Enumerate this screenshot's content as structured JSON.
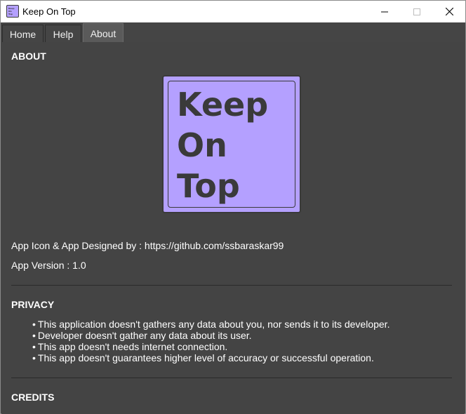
{
  "window": {
    "title": "Keep On Top",
    "icon_text": [
      "Keep",
      "On",
      "Top"
    ]
  },
  "tabs": [
    {
      "label": "Home",
      "selected": false
    },
    {
      "label": "Help",
      "selected": false
    },
    {
      "label": "About",
      "selected": true
    }
  ],
  "about": {
    "heading": "ABOUT",
    "logo_lines": [
      "Keep",
      "On",
      "Top"
    ],
    "designed_by": "App Icon & App Designed by : https://github.com/ssbaraskar99",
    "version": "App Version : 1.0"
  },
  "privacy": {
    "heading": "PRIVACY",
    "items": [
      "This application doesn't gathers any data about you, nor sends it to its developer.",
      "Developer doesn't gather any data about its user.",
      "This app doesn't needs internet connection.",
      "This app doesn't guarantees higher level of accuracy or successful operation."
    ]
  },
  "credits": {
    "heading": "CREDITS"
  },
  "colors": {
    "logo_bg": "#b4a0ff",
    "content_bg": "#444444",
    "titlebar_bg": "#ffffff"
  }
}
